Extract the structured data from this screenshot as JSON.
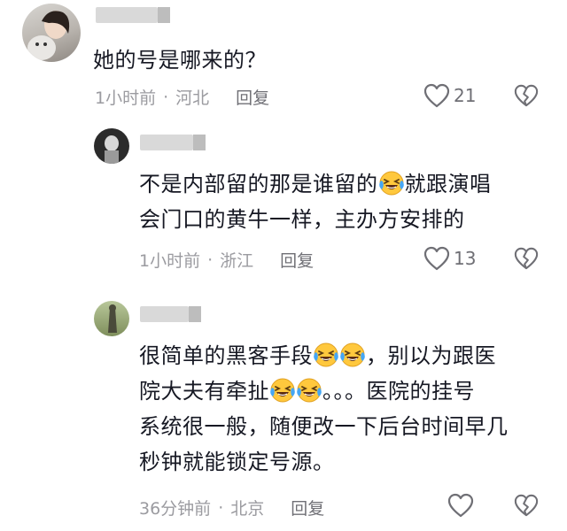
{
  "comments": [
    {
      "lines": [
        "她的号是哪来的？"
      ],
      "time": "1小时前",
      "location": "河北",
      "reply_label": "回复",
      "likes": "21"
    },
    {
      "lines": [
        "不是内部留的那是谁留的",
        "就跟演唱",
        "会门口的黄牛一样，主办方安排的"
      ],
      "time": "1小时前",
      "location": "浙江",
      "reply_label": "回复",
      "likes": "13"
    },
    {
      "lines": [
        "很简单的黑客手段",
        "，别以为跟医",
        "院大夫有牵扯",
        "。。。医院的挂号",
        "系统很一般，随便改一下后台时间早几",
        "秒钟就能锁定号源。"
      ],
      "time": "36分钟前",
      "location": "北京",
      "reply_label": "回复",
      "likes": ""
    }
  ],
  "separator": "·",
  "icons": {
    "like": "heart-outline-icon",
    "dislike": "broken-heart-icon",
    "emoji": "laughing-tears-emoji"
  },
  "colors": {
    "text": "#161823",
    "meta": "#9b9ba0",
    "icon": "#6f6f75",
    "emoji_face": "#ffc83d",
    "emoji_tears": "#45a6f4"
  }
}
